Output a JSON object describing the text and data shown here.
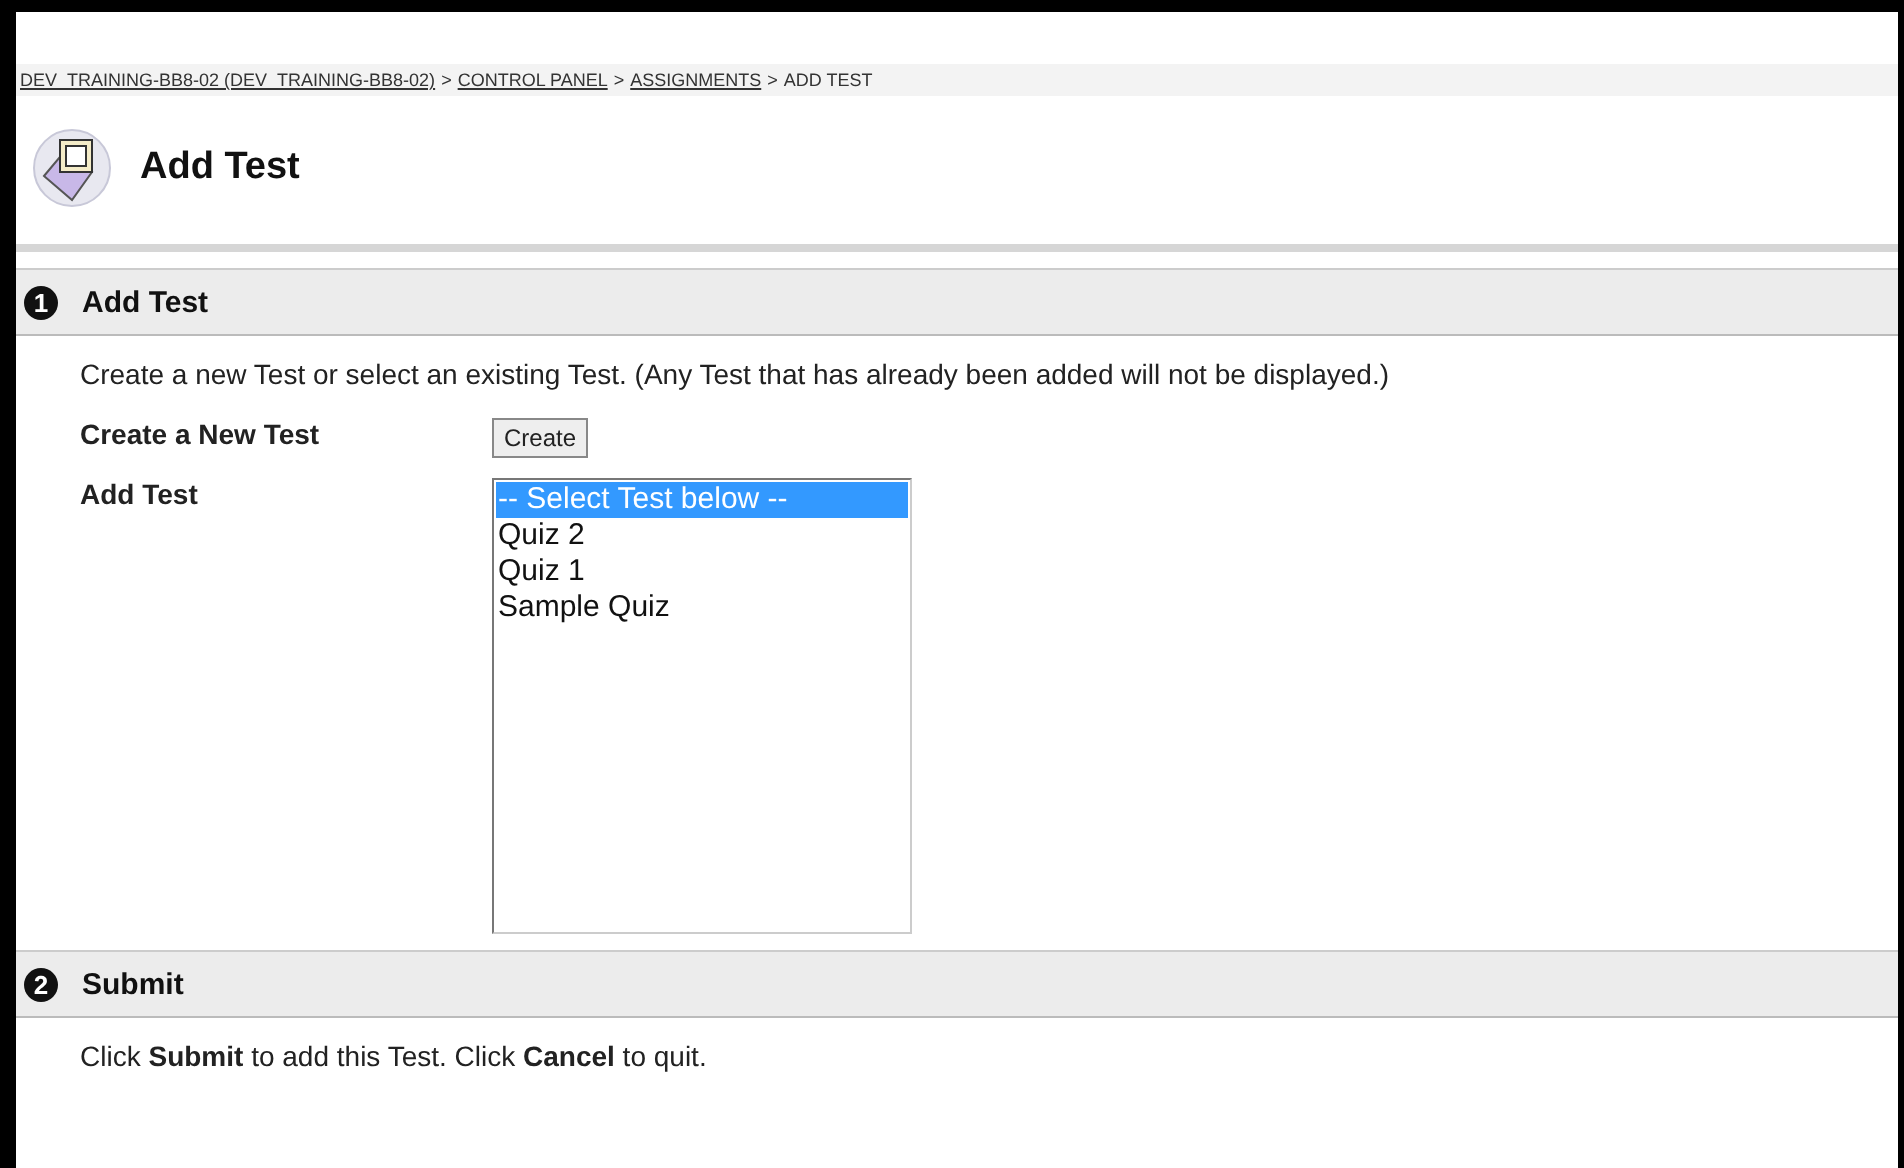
{
  "breadcrumb": {
    "separator": ">",
    "items": [
      {
        "label": "DEV_TRAINING-BB8-02 (DEV_TRAINING-BB8-02)",
        "link": true
      },
      {
        "label": "CONTROL PANEL",
        "link": true
      },
      {
        "label": "ASSIGNMENTS",
        "link": true
      },
      {
        "label": "ADD TEST",
        "link": false
      }
    ]
  },
  "page_title": "Add Test",
  "sections": [
    {
      "number": "1",
      "title": "Add Test",
      "kind": "form",
      "instructions": "Create a new Test or select an existing Test. (Any Test that has already been added will not be displayed.)",
      "create_label": "Create a New Test",
      "create_button": "Create",
      "list_label": "Add Test",
      "options": [
        {
          "label": "-- Select Test below --",
          "selected": true
        },
        {
          "label": "Quiz 2",
          "selected": false
        },
        {
          "label": "Quiz 1",
          "selected": false
        },
        {
          "label": "Sample Quiz",
          "selected": false
        }
      ]
    },
    {
      "number": "2",
      "title": "Submit",
      "kind": "text",
      "instructions": "Click **Submit** to add this Test. Click **Cancel** to quit."
    }
  ]
}
